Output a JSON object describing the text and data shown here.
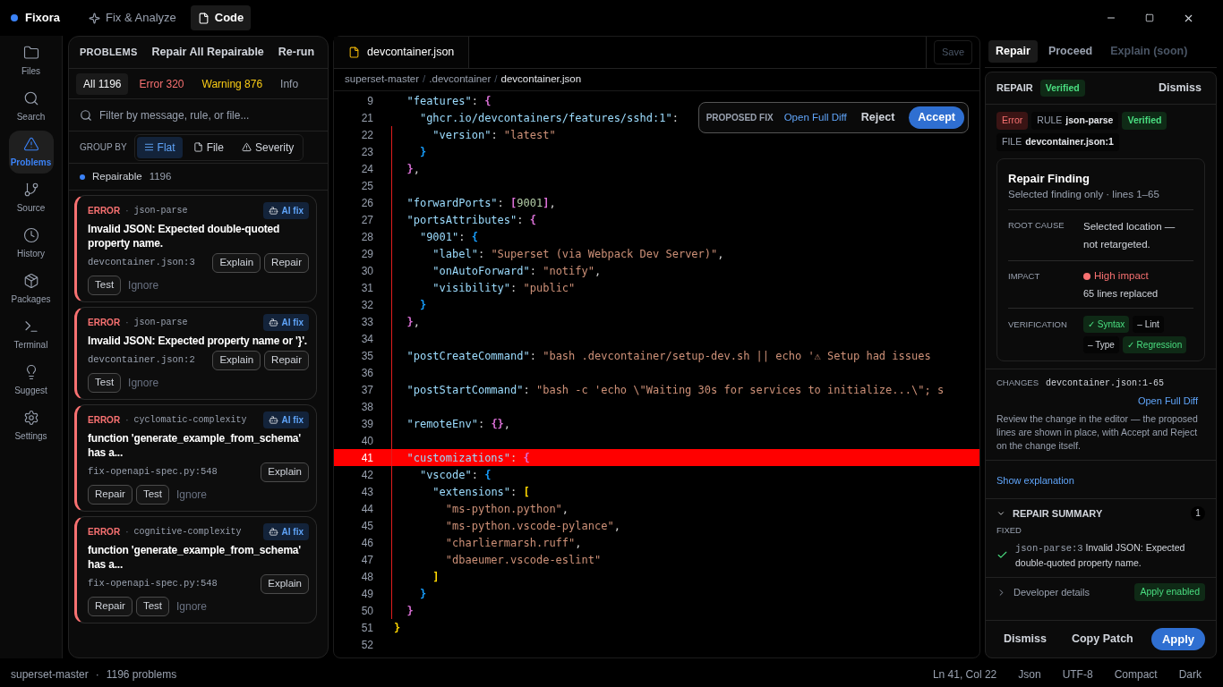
{
  "app": {
    "name": "Fixora"
  },
  "top_tabs": [
    {
      "label": "Fix & Analyze",
      "selected": false,
      "kind": "sparkle"
    },
    {
      "label": "Code",
      "selected": true,
      "kind": "file"
    }
  ],
  "nav": [
    {
      "label": "Files",
      "selected": false,
      "kind": "files"
    },
    {
      "label": "Search",
      "selected": false,
      "kind": "search"
    },
    {
      "label": "Problems",
      "selected": true,
      "kind": "problems"
    },
    {
      "label": "Source",
      "selected": false,
      "kind": "source"
    },
    {
      "label": "History",
      "selected": false,
      "kind": "history"
    },
    {
      "label": "Packages",
      "selected": false,
      "kind": "packages"
    },
    {
      "label": "Terminal",
      "selected": false,
      "kind": "terminal"
    },
    {
      "label": "Suggest",
      "selected": false,
      "kind": "suggest"
    },
    {
      "label": "Settings",
      "selected": false,
      "kind": "settings"
    }
  ],
  "problems": {
    "title": "PROBLEMS",
    "actions": [
      "Repair All Repairable",
      "Re-run"
    ],
    "filters": [
      {
        "label": "All 1196",
        "selected": true,
        "kind": "all"
      },
      {
        "label": "Error 320",
        "selected": false,
        "kind": "error"
      },
      {
        "label": "Warning 876",
        "selected": false,
        "kind": "warning"
      },
      {
        "label": "Info",
        "selected": false,
        "kind": "info"
      }
    ],
    "search": {
      "placeholder": "Filter by message, rule, or file..."
    },
    "group_by": {
      "label": "GROUP BY",
      "options": [
        {
          "label": "Flat",
          "selected": true,
          "kind": "flat"
        },
        {
          "label": "File",
          "selected": false,
          "kind": "file"
        },
        {
          "label": "Severity",
          "selected": false,
          "kind": "severity"
        }
      ]
    },
    "group": {
      "label": "Repairable",
      "count": "1196"
    },
    "items": [
      {
        "severity": "ERROR",
        "separator": "·",
        "rule": "json-parse",
        "badge": "AI fix",
        "title": "Invalid JSON: Expected double-quoted property name.",
        "location": "devcontainer.json:3",
        "top_actions": [
          {
            "label": "Explain",
            "kind": "button"
          },
          {
            "label": "Repair",
            "kind": "button"
          }
        ],
        "bottom_actions": [
          {
            "label": "Test",
            "kind": "button"
          },
          {
            "label": "Ignore",
            "kind": "link"
          }
        ]
      },
      {
        "severity": "ERROR",
        "separator": "·",
        "rule": "json-parse",
        "badge": "AI fix",
        "title": "Invalid JSON: Expected property name or '}'.",
        "location": "devcontainer.json:2",
        "top_actions": [
          {
            "label": "Explain",
            "kind": "button"
          },
          {
            "label": "Repair",
            "kind": "button"
          }
        ],
        "bottom_actions": [
          {
            "label": "Test",
            "kind": "button"
          },
          {
            "label": "Ignore",
            "kind": "link"
          }
        ]
      },
      {
        "severity": "ERROR",
        "separator": "·",
        "rule": "cyclomatic-complexity",
        "badge": "AI fix",
        "title": "function 'generate_example_from_schema' has a...",
        "location": "fix-openapi-spec.py:548",
        "top_actions": [
          {
            "label": "Explain",
            "kind": "button"
          }
        ],
        "bottom_actions": [
          {
            "label": "Repair",
            "kind": "button"
          },
          {
            "label": "Test",
            "kind": "button"
          },
          {
            "label": "Ignore",
            "kind": "link"
          }
        ]
      },
      {
        "severity": "ERROR",
        "separator": "·",
        "rule": "cognitive-complexity",
        "badge": "AI fix",
        "title": "function 'generate_example_from_schema' has a...",
        "location": "fix-openapi-spec.py:548",
        "top_actions": [
          {
            "label": "Explain",
            "kind": "button"
          }
        ],
        "bottom_actions": [
          {
            "label": "Repair",
            "kind": "button"
          },
          {
            "label": "Test",
            "kind": "button"
          },
          {
            "label": "Ignore",
            "kind": "link"
          }
        ]
      }
    ]
  },
  "editor": {
    "tab": "devcontainer.json",
    "save": {
      "label": "Save",
      "disabled": true
    },
    "breadcrumb": [
      {
        "text": "superset-master",
        "kind": "crumb"
      },
      {
        "text": "/",
        "kind": "separator"
      },
      {
        "text": ".devcontainer",
        "kind": "crumb"
      },
      {
        "text": "/",
        "kind": "separator"
      },
      {
        "text": "devcontainer.json",
        "kind": "current"
      }
    ],
    "proposed_fix": {
      "label": "PROPOSED FIX",
      "link": "Open Full Diff",
      "reject": "Reject",
      "accept": "Accept"
    },
    "lines": [
      {
        "n": "9",
        "changed": false,
        "highlighted": false,
        "tokens": [
          {
            "t": "  \"features\"",
            "kind": "key"
          },
          {
            "t": ": ",
            "kind": "punct"
          },
          {
            "t": "{",
            "kind": "bracket",
            "color": "#da70d6"
          }
        ]
      },
      {
        "n": "21",
        "changed": false,
        "highlighted": false,
        "tokens": [
          {
            "t": "    \"ghcr.io/devcontainers/features/sshd:1\"",
            "kind": "key"
          },
          {
            "t": ":",
            "kind": "punct"
          }
        ]
      },
      {
        "n": "22",
        "changed": true,
        "highlighted": false,
        "tokens": [
          {
            "t": "      \"version\"",
            "kind": "key"
          },
          {
            "t": ": ",
            "kind": "punct"
          },
          {
            "t": "\"latest\"",
            "kind": "string"
          }
        ]
      },
      {
        "n": "23",
        "changed": true,
        "highlighted": false,
        "tokens": [
          {
            "t": "    }",
            "kind": "bracket",
            "color": "#179fff"
          }
        ]
      },
      {
        "n": "24",
        "changed": true,
        "highlighted": false,
        "tokens": [
          {
            "t": "  }",
            "kind": "bracket",
            "color": "#da70d6"
          },
          {
            "t": ",",
            "kind": "punct"
          }
        ]
      },
      {
        "n": "25",
        "changed": true,
        "highlighted": false
      },
      {
        "n": "26",
        "changed": true,
        "highlighted": false,
        "tokens": [
          {
            "t": "  \"forwardPorts\"",
            "kind": "key"
          },
          {
            "t": ": ",
            "kind": "punct"
          },
          {
            "t": "[",
            "kind": "bracket",
            "color": "#da70d6"
          },
          {
            "t": "9001",
            "kind": "number"
          },
          {
            "t": "]",
            "kind": "bracket",
            "color": "#da70d6"
          },
          {
            "t": ",",
            "kind": "punct"
          }
        ]
      },
      {
        "n": "27",
        "changed": true,
        "highlighted": false,
        "tokens": [
          {
            "t": "  \"portsAttributes\"",
            "kind": "key"
          },
          {
            "t": ": ",
            "kind": "punct"
          },
          {
            "t": "{",
            "kind": "bracket",
            "color": "#da70d6"
          }
        ]
      },
      {
        "n": "28",
        "changed": true,
        "highlighted": false,
        "tokens": [
          {
            "t": "    \"9001\"",
            "kind": "key"
          },
          {
            "t": ": ",
            "kind": "punct"
          },
          {
            "t": "{",
            "kind": "bracket",
            "color": "#179fff"
          }
        ]
      },
      {
        "n": "29",
        "changed": true,
        "highlighted": false,
        "tokens": [
          {
            "t": "      \"label\"",
            "kind": "key"
          },
          {
            "t": ": ",
            "kind": "punct"
          },
          {
            "t": "\"Superset (via Webpack Dev Server)\"",
            "kind": "string"
          },
          {
            "t": ",",
            "kind": "punct"
          }
        ]
      },
      {
        "n": "30",
        "changed": true,
        "highlighted": false,
        "tokens": [
          {
            "t": "      \"onAutoForward\"",
            "kind": "key"
          },
          {
            "t": ": ",
            "kind": "punct"
          },
          {
            "t": "\"notify\"",
            "kind": "string"
          },
          {
            "t": ",",
            "kind": "punct"
          }
        ]
      },
      {
        "n": "31",
        "changed": true,
        "highlighted": false,
        "tokens": [
          {
            "t": "      \"visibility\"",
            "kind": "key"
          },
          {
            "t": ": ",
            "kind": "punct"
          },
          {
            "t": "\"public\"",
            "kind": "string"
          }
        ]
      },
      {
        "n": "32",
        "changed": true,
        "highlighted": false,
        "tokens": [
          {
            "t": "    }",
            "kind": "bracket",
            "color": "#179fff"
          }
        ]
      },
      {
        "n": "33",
        "changed": true,
        "highlighted": false,
        "tokens": [
          {
            "t": "  }",
            "kind": "bracket",
            "color": "#da70d6"
          },
          {
            "t": ",",
            "kind": "punct"
          }
        ]
      },
      {
        "n": "34",
        "changed": true,
        "highlighted": false
      },
      {
        "n": "35",
        "changed": true,
        "highlighted": false,
        "tokens": [
          {
            "t": "  \"postCreateCommand\"",
            "kind": "key"
          },
          {
            "t": ": ",
            "kind": "punct"
          },
          {
            "t": "\"bash .devcontainer/setup-dev.sh || echo '⚠ Setup had issues",
            "kind": "string"
          }
        ]
      },
      {
        "n": "36",
        "changed": true,
        "highlighted": false
      },
      {
        "n": "37",
        "changed": true,
        "highlighted": false,
        "tokens": [
          {
            "t": "  \"postStartCommand\"",
            "kind": "key"
          },
          {
            "t": ": ",
            "kind": "punct"
          },
          {
            "t": "\"bash -c 'echo \\\"Waiting 30s for services to initialize...\\\"; s",
            "kind": "string"
          }
        ]
      },
      {
        "n": "38",
        "changed": true,
        "highlighted": false
      },
      {
        "n": "39",
        "changed": true,
        "highlighted": false,
        "tokens": [
          {
            "t": "  \"remoteEnv\"",
            "kind": "key"
          },
          {
            "t": ": ",
            "kind": "punct"
          },
          {
            "t": "{}",
            "kind": "bracket",
            "color": "#da70d6"
          },
          {
            "t": ",",
            "kind": "punct"
          }
        ]
      },
      {
        "n": "40",
        "changed": true,
        "highlighted": false
      },
      {
        "n": "41",
        "changed": true,
        "highlighted": true,
        "tokens": [
          {
            "t": "  \"customizations\"",
            "kind": "key"
          },
          {
            "t": ": ",
            "kind": "punct"
          },
          {
            "t": "{",
            "kind": "bracket",
            "color": "#da70d6"
          }
        ]
      },
      {
        "n": "42",
        "changed": true,
        "highlighted": false,
        "tokens": [
          {
            "t": "    \"vscode\"",
            "kind": "key"
          },
          {
            "t": ": ",
            "kind": "punct"
          },
          {
            "t": "{",
            "kind": "bracket",
            "color": "#179fff"
          }
        ]
      },
      {
        "n": "43",
        "changed": true,
        "highlighted": false,
        "tokens": [
          {
            "t": "      \"extensions\"",
            "kind": "key"
          },
          {
            "t": ": ",
            "kind": "punct"
          },
          {
            "t": "[",
            "kind": "bracket",
            "color": "#ffd700"
          }
        ]
      },
      {
        "n": "44",
        "changed": true,
        "highlighted": false,
        "tokens": [
          {
            "t": "        \"ms-python.python\"",
            "kind": "string"
          },
          {
            "t": ",",
            "kind": "punct"
          }
        ]
      },
      {
        "n": "45",
        "changed": true,
        "highlighted": false,
        "tokens": [
          {
            "t": "        \"ms-python.vscode-pylance\"",
            "kind": "string"
          },
          {
            "t": ",",
            "kind": "punct"
          }
        ]
      },
      {
        "n": "46",
        "changed": true,
        "highlighted": false,
        "tokens": [
          {
            "t": "        \"charliermarsh.ruff\"",
            "kind": "string"
          },
          {
            "t": ",",
            "kind": "punct"
          }
        ]
      },
      {
        "n": "47",
        "changed": true,
        "highlighted": false,
        "tokens": [
          {
            "t": "        \"dbaeumer.vscode-eslint\"",
            "kind": "string"
          }
        ]
      },
      {
        "n": "48",
        "changed": true,
        "highlighted": false,
        "tokens": [
          {
            "t": "      ]",
            "kind": "bracket",
            "color": "#ffd700"
          }
        ]
      },
      {
        "n": "49",
        "changed": true,
        "highlighted": false,
        "tokens": [
          {
            "t": "    }",
            "kind": "bracket",
            "color": "#179fff"
          }
        ]
      },
      {
        "n": "50",
        "changed": true,
        "highlighted": false,
        "tokens": [
          {
            "t": "  }",
            "kind": "bracket",
            "color": "#da70d6"
          }
        ]
      },
      {
        "n": "51",
        "changed": false,
        "highlighted": false,
        "tokens": [
          {
            "t": "}",
            "kind": "bracket",
            "color": "#ffd700"
          }
        ]
      },
      {
        "n": "52",
        "changed": false,
        "highlighted": false
      }
    ]
  },
  "repair": {
    "tabs": [
      {
        "label": "Repair",
        "selected": true,
        "disabled": false
      },
      {
        "label": "Proceed",
        "selected": false,
        "disabled": false
      },
      {
        "label": "Explain (soon)",
        "selected": false,
        "disabled": true
      }
    ],
    "header": {
      "title": "REPAIR",
      "status": "Verified",
      "dismiss": "Dismiss"
    },
    "tags": [
      {
        "kind": "error",
        "value": "Error"
      },
      {
        "kind": "labeled",
        "label": "RULE",
        "value": "json-parse"
      },
      {
        "kind": "verified",
        "value": "Verified"
      },
      {
        "kind": "labeled",
        "label": "FILE",
        "value": "devcontainer.json:1"
      }
    ],
    "finding": {
      "title": "Repair Finding",
      "subtitle": "Selected finding only · lines 1–65",
      "root_cause": {
        "label": "ROOT CAUSE",
        "value": "Selected location — not retargeted."
      },
      "impact": {
        "label": "IMPACT",
        "level": "High impact",
        "detail": "65 lines replaced",
        "color": "#f87171"
      },
      "verification": {
        "label": "VERIFICATION",
        "checks": [
          {
            "label": "✓ Syntax",
            "passed": true
          },
          {
            "label": "– Lint",
            "passed": false
          },
          {
            "label": "– Type",
            "passed": false
          },
          {
            "label": "✓ Regression",
            "passed": true
          }
        ]
      }
    },
    "changes": {
      "label": "CHANGES",
      "range": "devcontainer.json:1-65",
      "link": "Open Full Diff",
      "note": "Review the change in the editor — the proposed lines are shown in place, with Accept and Reject on the change itself."
    },
    "explanation_link": "Show explanation",
    "summary": {
      "title": "REPAIR SUMMARY",
      "count": "1",
      "expanded": true,
      "section": "FIXED",
      "items": [
        {
          "code": "json-parse:3",
          "text": "Invalid JSON: Expected double-quoted property name."
        }
      ]
    },
    "developer": {
      "label": "Developer details",
      "expanded": false,
      "badge": "Apply enabled"
    },
    "footer": [
      "Dismiss",
      "Copy Patch",
      "Apply"
    ]
  },
  "status_bar": {
    "left": [
      "superset-master",
      "·",
      "1196 problems"
    ],
    "right": [
      "Ln 41, Col 22",
      "Json",
      "UTF-8",
      "Compact",
      "Dark"
    ]
  }
}
